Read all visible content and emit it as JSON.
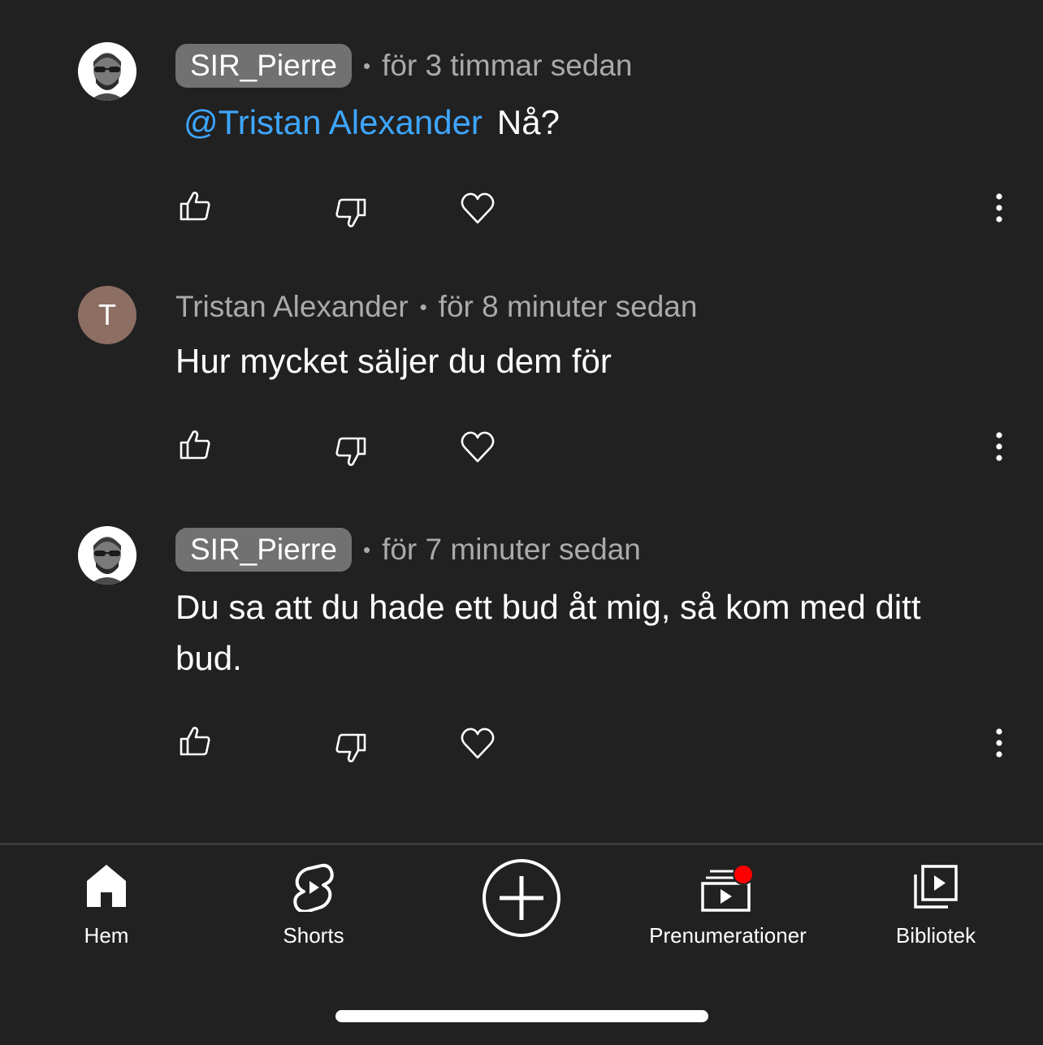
{
  "comments": [
    {
      "author": "SIR_Pierre",
      "author_style": "pill",
      "avatar": "profile-photo",
      "separator": "•",
      "time": "för 3 timmar sedan",
      "mention": "@Tristan Alexander",
      "text": "Nå?"
    },
    {
      "author": "Tristan Alexander",
      "author_style": "plain",
      "avatar_letter": "T",
      "avatar_color": "#8d6e63",
      "separator": "•",
      "time": "för 8 minuter sedan",
      "text": "Hur mycket säljer du dem för"
    },
    {
      "author": "SIR_Pierre",
      "author_style": "pill",
      "avatar": "profile-photo",
      "separator": "•",
      "time": "för 7 minuter sedan",
      "text": "Du sa att du hade ett bud åt mig, så kom med ditt bud."
    }
  ],
  "actions": [
    "like-icon",
    "dislike-icon",
    "heart-icon",
    "more-icon"
  ],
  "nav": {
    "home": "Hem",
    "shorts": "Shorts",
    "create": "create-icon",
    "subscriptions": "Prenumerationer",
    "library": "Bibliotek"
  },
  "colors": {
    "background": "#212121",
    "mention": "#3ea6ff",
    "pill": "#717171",
    "secondary_text": "#aaaaaa",
    "notification_dot": "#ff0000"
  }
}
